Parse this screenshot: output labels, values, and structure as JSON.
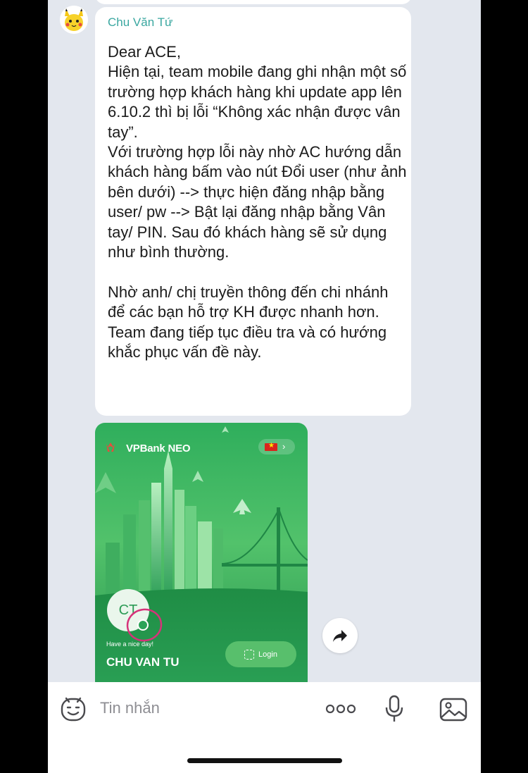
{
  "chat": {
    "sender_name": "Chu Văn Tứ",
    "message_text": "Dear ACE,\nHiện tại, team mobile đang ghi nhận một số trường hợp khách hàng khi update app lên 6.10.2 thì bị lỗi “Không xác nhận được vân tay”.\nVới trường hợp lỗi này nhờ AC hướng dẫn khách hàng bấm vào nút Đổi user (như ảnh bên dưới) --> thực hiện đăng nhập bằng user/ pw --> Bật lại đăng nhập bằng Vân tay/ PIN. Sau đó khách hàng sẽ sử dụng như bình thường.\n\nNhờ anh/ chị truyền thông đến chi nhánh để các bạn hỗ trợ KH được nhanh hơn.\nTeam đang tiếp tục điều tra và có hướng khắc phục vấn đề này."
  },
  "screenshot": {
    "brand": "VPBank NEO",
    "avatar_initials": "CT",
    "greeting": "Have a nice day!",
    "user_name": "CHU VAN TU",
    "login_label": "Login"
  },
  "composer": {
    "placeholder": "Tin nhắn"
  },
  "icons": {
    "avatar": "pikachu-avatar",
    "share": "share-arrow-icon",
    "emoji": "emoji-icon",
    "more": "more-dots-icon",
    "mic": "microphone-icon",
    "gallery": "image-gallery-icon"
  },
  "colors": {
    "sender": "#3aa7a0",
    "chat_background": "#e3e7ee",
    "annotation_circle": "#d6337a"
  }
}
